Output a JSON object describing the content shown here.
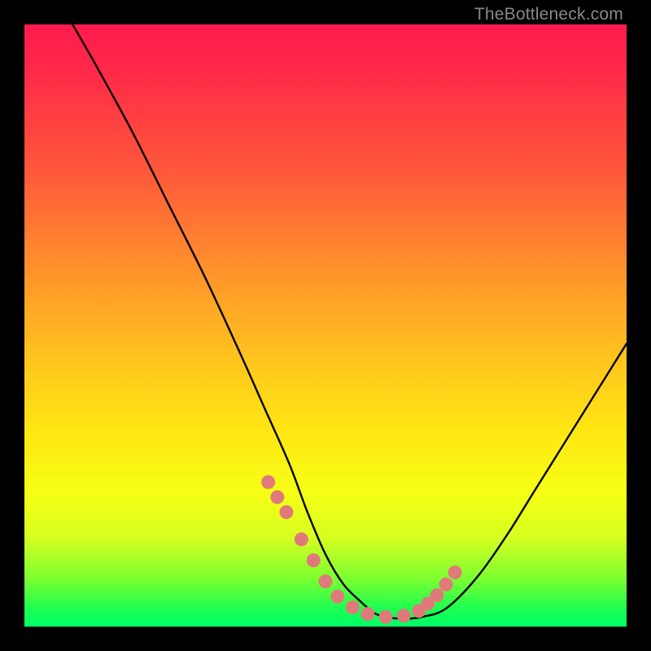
{
  "watermark": "TheBottleneck.com",
  "chart_data": {
    "type": "line",
    "title": "",
    "xlabel": "",
    "ylabel": "",
    "xlim": [
      0,
      100
    ],
    "ylim": [
      0,
      100
    ],
    "series": [
      {
        "name": "curve",
        "x": [
          8,
          12,
          18,
          24,
          30,
          36,
          40,
          44,
          47,
          50,
          53,
          56,
          58,
          60,
          63,
          66,
          70,
          75,
          80,
          85,
          90,
          95,
          100
        ],
        "y": [
          100,
          93,
          82,
          70,
          58,
          45,
          36,
          27,
          19,
          12,
          7,
          4,
          2.3,
          1.6,
          1.3,
          1.6,
          3,
          8,
          15,
          23,
          31,
          39,
          47
        ]
      }
    ],
    "markers": {
      "name": "marker-dots",
      "color": "#e07a7a",
      "x": [
        40.5,
        42,
        43.5,
        46,
        48,
        50,
        52,
        54.5,
        57,
        60,
        63,
        65.5,
        67,
        68.5,
        70,
        71.5
      ],
      "y": [
        24,
        21.5,
        19,
        14.5,
        11,
        7.5,
        5,
        3.2,
        2.1,
        1.6,
        1.8,
        2.6,
        3.8,
        5.2,
        7,
        9
      ]
    },
    "background_gradient": {
      "top": "#ff1a4d",
      "mid": "#ffe812",
      "bottom": "#00ff66"
    }
  }
}
